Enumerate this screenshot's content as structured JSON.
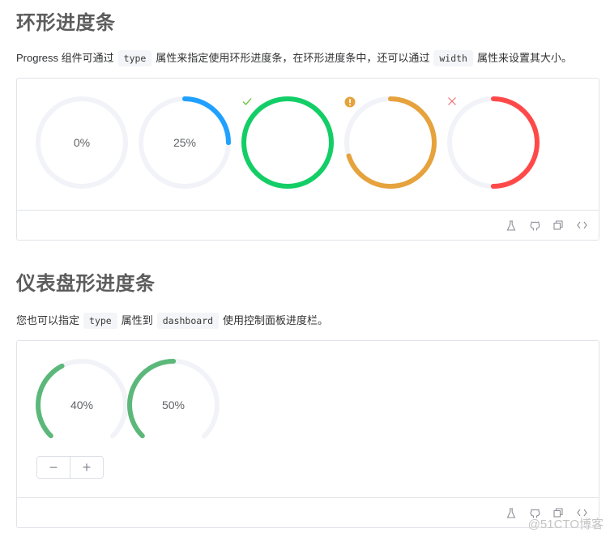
{
  "section1": {
    "title": "环形进度条",
    "desc_before": "Progress 组件可通过",
    "code1": "type",
    "desc_middle": "属性来指定使用环形进度条，在环形进度条中，还可以通过",
    "code2": "width",
    "desc_after": "属性来设置其大小。",
    "progress": [
      {
        "percentage": 0,
        "status": "default",
        "label": "0%",
        "color": "#409eff"
      },
      {
        "percentage": 25,
        "status": "default",
        "label": "25%",
        "color": "#20a0ff"
      },
      {
        "percentage": 100,
        "status": "success",
        "icon": "check-icon",
        "color": "#13ce66"
      },
      {
        "percentage": 70,
        "status": "warning",
        "icon": "warning-icon",
        "color": "#e6a23c"
      },
      {
        "percentage": 50,
        "status": "exception",
        "icon": "close-icon",
        "color": "#ff4949"
      }
    ]
  },
  "section2": {
    "title": "仪表盘形进度条",
    "desc_before": "您也可以指定",
    "code1": "type",
    "desc_middle": "属性到",
    "code2": "dashboard",
    "desc_after": "使用控制面板进度栏。",
    "progress": [
      {
        "percentage": 40,
        "label": "40%",
        "color": "#5cb87a"
      },
      {
        "percentage": 50,
        "label": "50%",
        "color": "#5cb87a"
      }
    ],
    "decrease_label": "−",
    "increase_label": "+"
  },
  "toolbar": {
    "icons": [
      "playground-icon",
      "github-icon",
      "copy-icon",
      "code-icon"
    ]
  },
  "colors": {
    "track": "#f2f3f8"
  },
  "watermark": "@51CTO博客"
}
